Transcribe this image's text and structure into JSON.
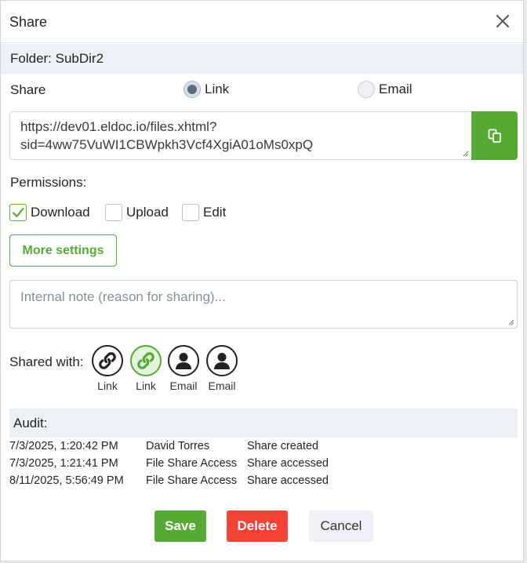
{
  "dialog": {
    "title": "Share",
    "folder": "Folder: SubDir2"
  },
  "share": {
    "label": "Share",
    "options": [
      {
        "label": "Link",
        "selected": true
      },
      {
        "label": "Email",
        "selected": false
      }
    ],
    "url_line1": "https://dev01.eldoc.io/files.xhtml?",
    "url_line2": "sid=4ww75VuWI1CBWpkh3Vcf4XgiA01oMs0xpQ"
  },
  "permissions": {
    "label": "Permissions:",
    "items": [
      {
        "label": "Download",
        "checked": true
      },
      {
        "label": "Upload",
        "checked": false
      },
      {
        "label": "Edit",
        "checked": false
      }
    ]
  },
  "more_settings_label": "More settings",
  "note": {
    "placeholder": "Internal note (reason for sharing)..."
  },
  "shared_with": {
    "label": "Shared with:",
    "items": [
      {
        "icon": "link-icon",
        "label": "Link",
        "selected": false
      },
      {
        "icon": "link-icon",
        "label": "Link",
        "selected": true
      },
      {
        "icon": "user-icon",
        "label": "Email",
        "selected": false
      },
      {
        "icon": "user-icon",
        "label": "Email",
        "selected": false
      }
    ]
  },
  "audit": {
    "label": "Audit:",
    "rows": [
      {
        "time": "7/3/2025, 1:20:42 PM",
        "user": "David Torres",
        "action": "Share created"
      },
      {
        "time": "7/3/2025, 1:21:41 PM",
        "user": "File Share Access",
        "action": "Share accessed"
      },
      {
        "time": "8/11/2025, 5:56:49 PM",
        "user": "File Share Access",
        "action": "Share accessed"
      }
    ]
  },
  "buttons": {
    "save": "Save",
    "delete": "Delete",
    "cancel": "Cancel"
  },
  "colors": {
    "accent": "#56a932",
    "danger": "#f44336",
    "band": "#edf1f6"
  }
}
